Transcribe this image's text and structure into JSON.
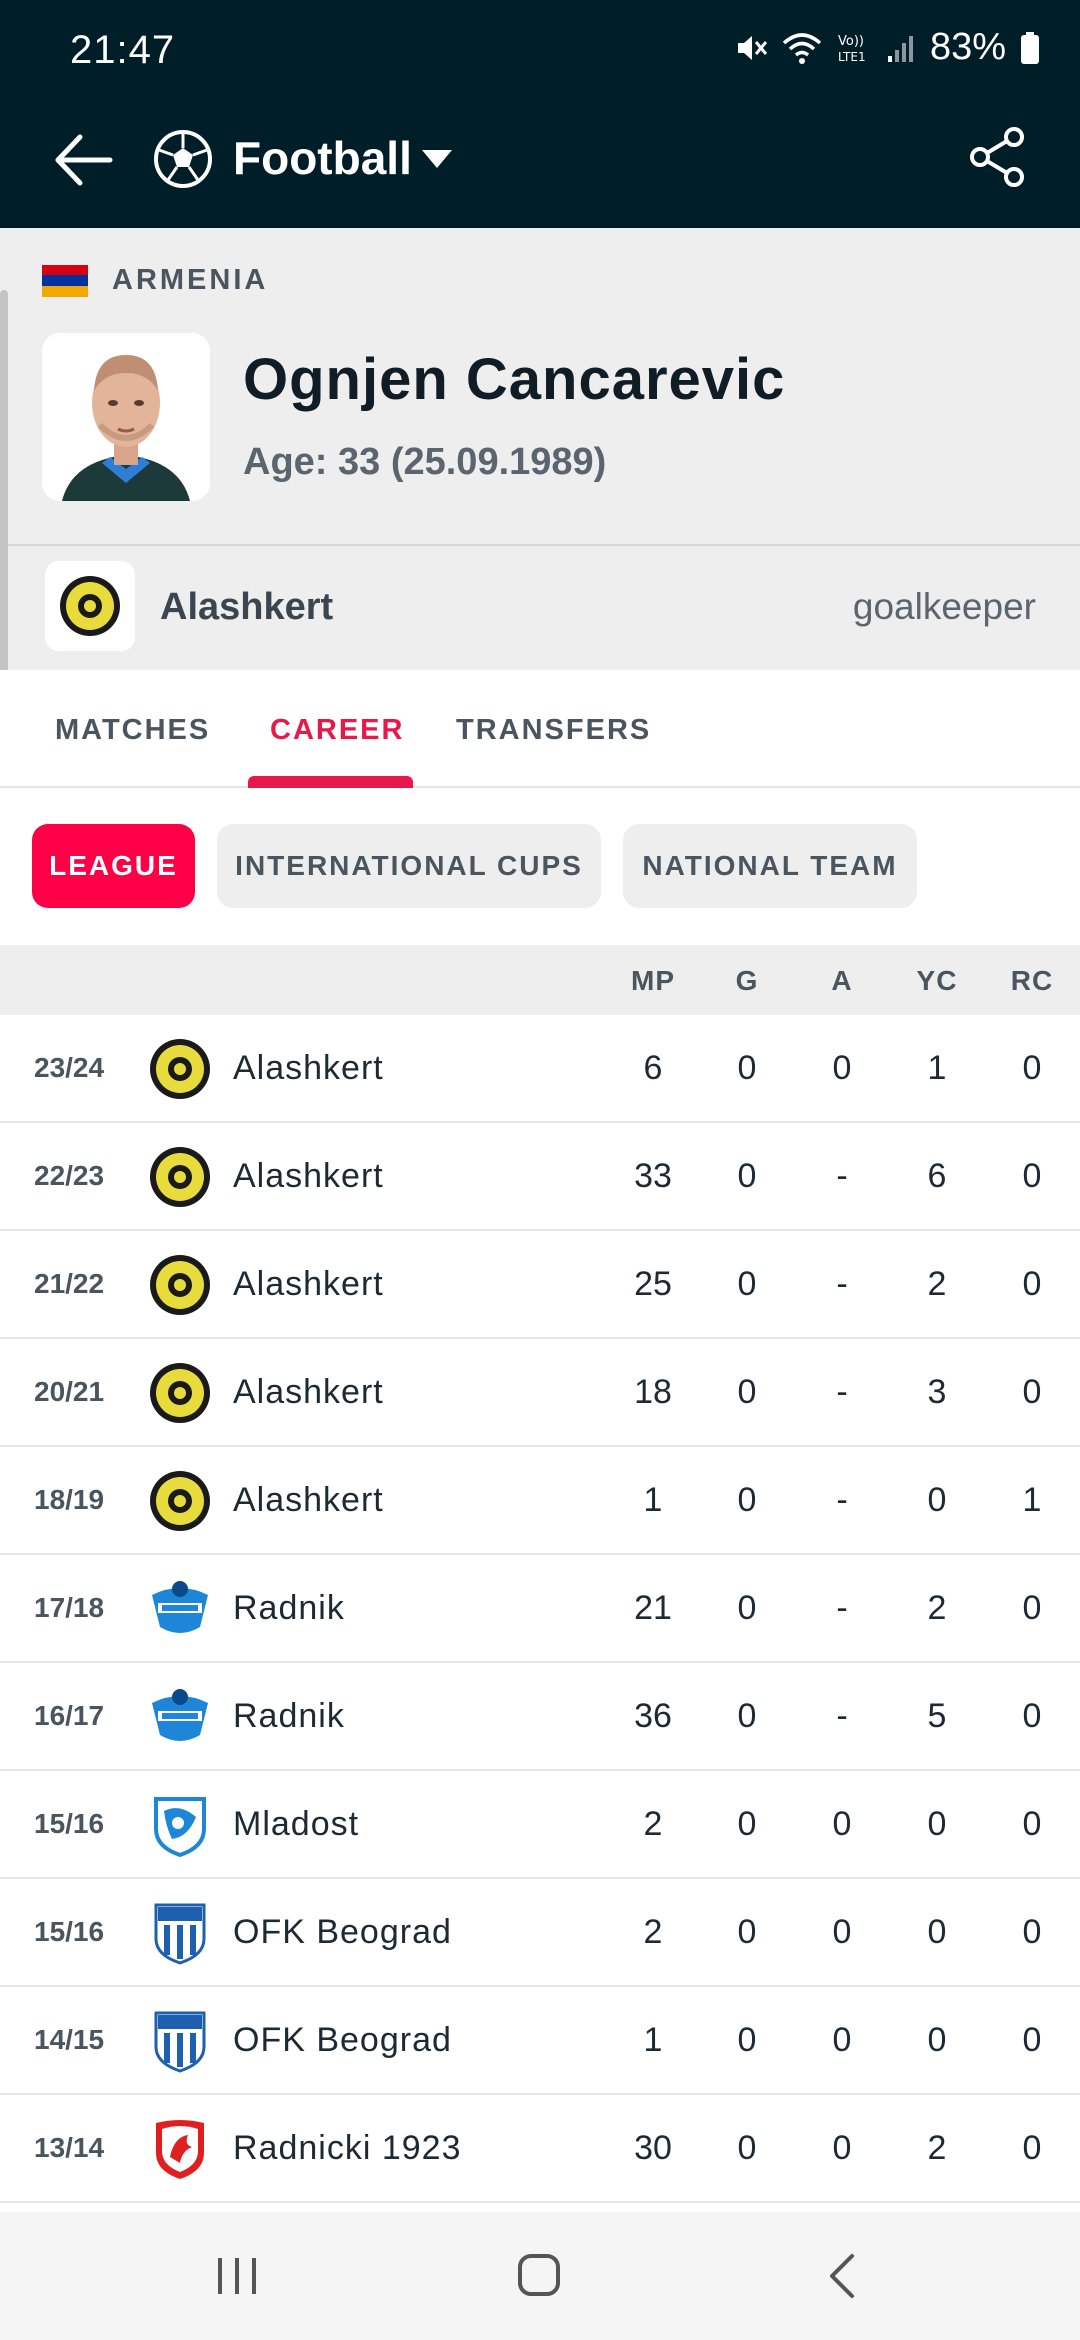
{
  "status_bar": {
    "time": "21:47",
    "battery": "83%"
  },
  "app_bar": {
    "sport": "Football",
    "icons": [
      "back-arrow-icon",
      "football-icon",
      "dropdown-caret-icon",
      "share-icon"
    ]
  },
  "player": {
    "country": "ARMENIA",
    "name": "Ognjen Cancarevic",
    "age": "Age: 33 (25.09.1989)",
    "team": "Alashkert",
    "position": "goalkeeper"
  },
  "tabs": [
    {
      "label": "MATCHES",
      "active": false
    },
    {
      "label": "CAREER",
      "active": true
    },
    {
      "label": "TRANSFERS",
      "active": false
    }
  ],
  "filters": [
    {
      "label": "LEAGUE",
      "active": true
    },
    {
      "label": "INTERNATIONAL CUPS",
      "active": false
    },
    {
      "label": "NATIONAL TEAM",
      "active": false
    }
  ],
  "table": {
    "columns": [
      "MP",
      "G",
      "A",
      "YC",
      "RC"
    ],
    "rows": [
      {
        "season": "23/24",
        "club": "Alashkert",
        "crest": "alashkert",
        "mp": "6",
        "g": "0",
        "a": "0",
        "yc": "1",
        "rc": "0"
      },
      {
        "season": "22/23",
        "club": "Alashkert",
        "crest": "alashkert",
        "mp": "33",
        "g": "0",
        "a": "-",
        "yc": "6",
        "rc": "0"
      },
      {
        "season": "21/22",
        "club": "Alashkert",
        "crest": "alashkert",
        "mp": "25",
        "g": "0",
        "a": "-",
        "yc": "2",
        "rc": "0"
      },
      {
        "season": "20/21",
        "club": "Alashkert",
        "crest": "alashkert",
        "mp": "18",
        "g": "0",
        "a": "-",
        "yc": "3",
        "rc": "0"
      },
      {
        "season": "18/19",
        "club": "Alashkert",
        "crest": "alashkert",
        "mp": "1",
        "g": "0",
        "a": "-",
        "yc": "0",
        "rc": "1"
      },
      {
        "season": "17/18",
        "club": "Radnik",
        "crest": "radnik",
        "mp": "21",
        "g": "0",
        "a": "-",
        "yc": "2",
        "rc": "0"
      },
      {
        "season": "16/17",
        "club": "Radnik",
        "crest": "radnik",
        "mp": "36",
        "g": "0",
        "a": "-",
        "yc": "5",
        "rc": "0"
      },
      {
        "season": "15/16",
        "club": "Mladost",
        "crest": "mladost",
        "mp": "2",
        "g": "0",
        "a": "0",
        "yc": "0",
        "rc": "0"
      },
      {
        "season": "15/16",
        "club": "OFK Beograd",
        "crest": "ofk",
        "mp": "2",
        "g": "0",
        "a": "0",
        "yc": "0",
        "rc": "0"
      },
      {
        "season": "14/15",
        "club": "OFK Beograd",
        "crest": "ofk",
        "mp": "1",
        "g": "0",
        "a": "0",
        "yc": "0",
        "rc": "0"
      },
      {
        "season": "13/14",
        "club": "Radnicki 1923",
        "crest": "radnicki",
        "mp": "30",
        "g": "0",
        "a": "0",
        "yc": "2",
        "rc": "0"
      }
    ]
  },
  "colors": {
    "header_bg": "#001e28",
    "accent": "#ff0046",
    "flag": [
      "#d90012",
      "#0033a0",
      "#f2a800"
    ]
  }
}
